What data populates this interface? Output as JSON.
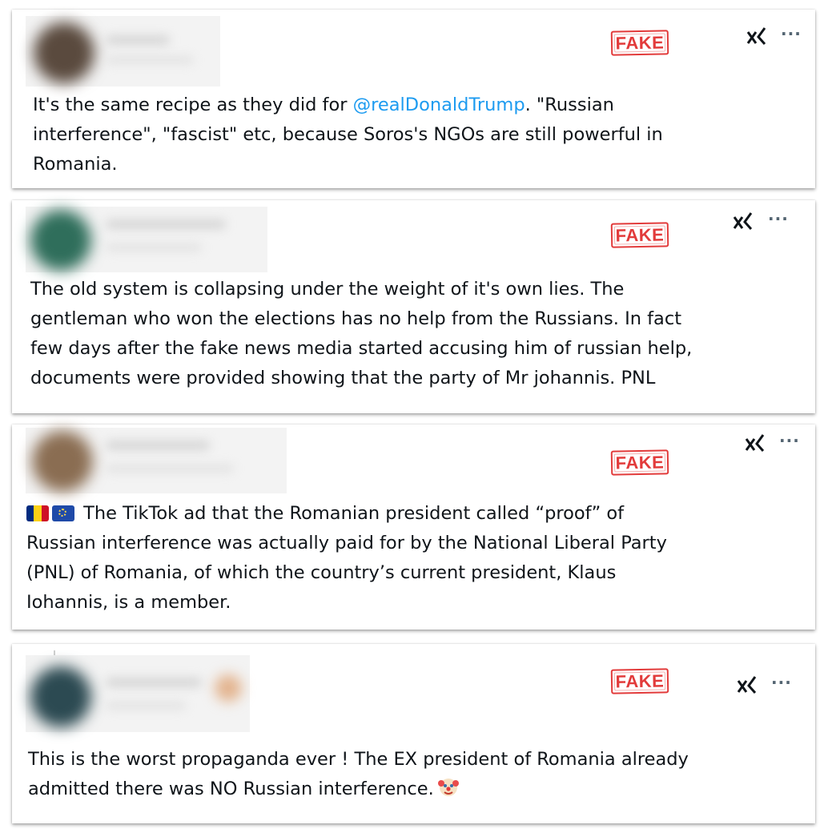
{
  "colors": {
    "stamp": "#e23b3b",
    "mention": "#1d9bf0",
    "text": "#0f1419",
    "icon": "#536471"
  },
  "icons": {
    "grok": "grok-icon",
    "more": "more-icon",
    "clown": "clown-face-emoji",
    "flag_romania": "romania-flag-emoji",
    "flag_eu": "eu-flag-emoji"
  },
  "posts": [
    {
      "stamp": "FAKE",
      "more": "···",
      "text_before_mention": "It's the same recipe as they did for ",
      "mention": "@realDonaldTrump",
      "text_after_mention": ". \"Russian\ninterference\", \"fascist\" etc, because Soros's NGOs are still powerful in\nRomania."
    },
    {
      "stamp": "FAKE",
      "more": "···",
      "text": "The old system is collapsing under the weight of it's own lies. The\ngentleman who won the elections has no help from the Russians. In fact\nfew days after the fake news media started accusing him of russian help,\ndocuments were provided showing that the party of Mr johannis. PNL"
    },
    {
      "stamp": "FAKE",
      "more": "···",
      "text": " The TikTok ad that the Romanian president called “proof” of\nRussian interference was actually paid for by the National Liberal Party\n(PNL) of Romania, of which the country’s current president, Klaus\nIohannis, is a member."
    },
    {
      "stamp": "FAKE",
      "more": "···",
      "text": "This is the worst propaganda ever ! The EX president of Romania already\nadmitted there was NO Russian interference."
    }
  ]
}
